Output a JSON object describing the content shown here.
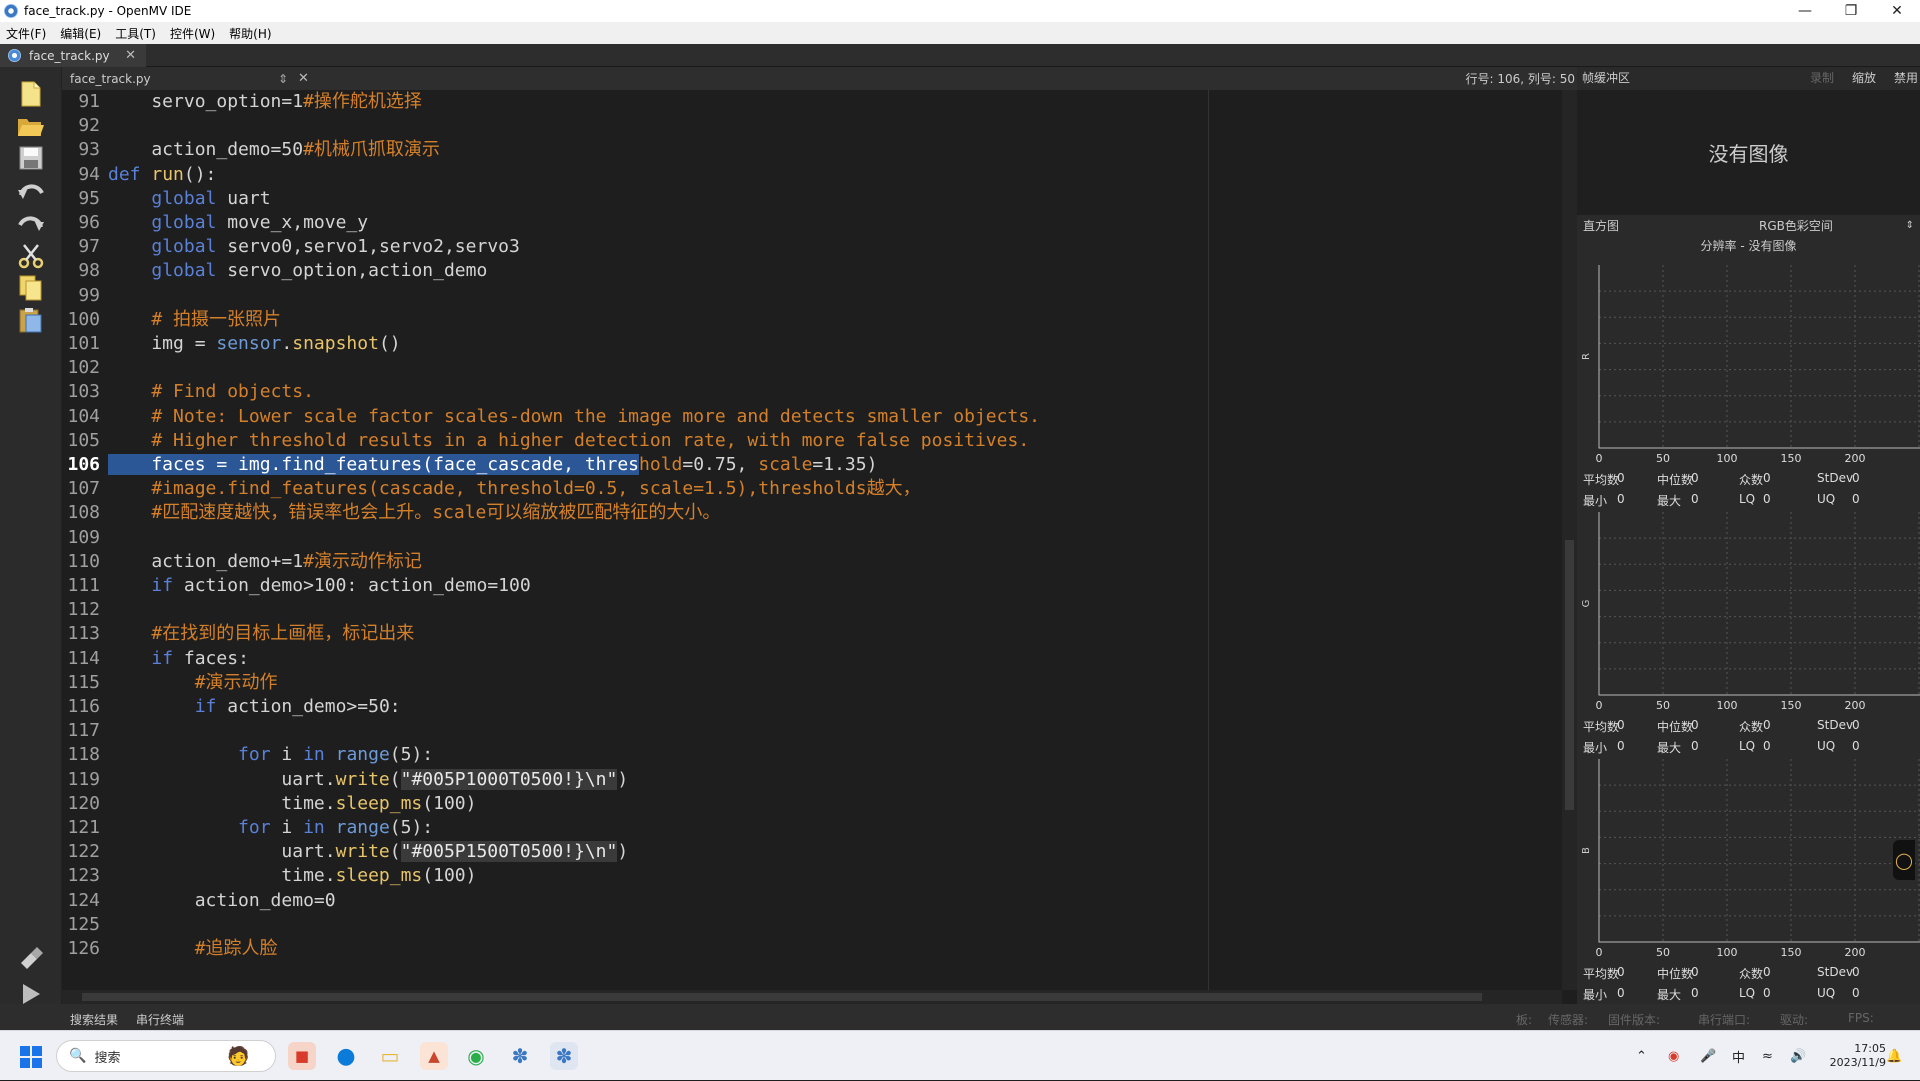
{
  "window": {
    "title": "face_track.py - OpenMV IDE"
  },
  "menu": [
    "文件(F)",
    "编辑(E)",
    "工具(T)",
    "控件(W)",
    "帮助(H)"
  ],
  "tab": {
    "label": "face_track.py"
  },
  "editor": {
    "filename": "face_track.py",
    "position": "行号: 106, 列号: 50",
    "lines": [
      {
        "n": "91",
        "t": "    servo_option=1#操作舵机选择"
      },
      {
        "n": "92",
        "t": ""
      },
      {
        "n": "93",
        "t": "    action_demo=50#机械爪抓取演示"
      },
      {
        "n": "94",
        "t": "def run():"
      },
      {
        "n": "95",
        "t": "    global uart"
      },
      {
        "n": "96",
        "t": "    global move_x,move_y"
      },
      {
        "n": "97",
        "t": "    global servo0,servo1,servo2,servo3"
      },
      {
        "n": "98",
        "t": "    global servo_option,action_demo"
      },
      {
        "n": "99",
        "t": ""
      },
      {
        "n": "100",
        "t": "    # 拍摄一张照片"
      },
      {
        "n": "101",
        "t": "    img = sensor.snapshot()"
      },
      {
        "n": "102",
        "t": ""
      },
      {
        "n": "103",
        "t": "    # Find objects."
      },
      {
        "n": "104",
        "t": "    # Note: Lower scale factor scales-down the image more and detects smaller objects."
      },
      {
        "n": "105",
        "t": "    # Higher threshold results in a higher detection rate, with more false positives."
      },
      {
        "n": "106",
        "t": "    faces = img.find_features(face_cascade, threshold=0.75, scale=1.35)"
      },
      {
        "n": "107",
        "t": "    #image.find_features(cascade, threshold=0.5, scale=1.5),thresholds越大，"
      },
      {
        "n": "108",
        "t": "    #匹配速度越快，错误率也会上升。scale可以缩放被匹配特征的大小。"
      },
      {
        "n": "109",
        "t": ""
      },
      {
        "n": "110",
        "t": "    action_demo+=1#演示动作标记"
      },
      {
        "n": "111",
        "t": "    if action_demo>100: action_demo=100"
      },
      {
        "n": "112",
        "t": ""
      },
      {
        "n": "113",
        "t": "    #在找到的目标上画框，标记出来"
      },
      {
        "n": "114",
        "t": "    if faces:"
      },
      {
        "n": "115",
        "t": "        #演示动作"
      },
      {
        "n": "116",
        "t": "        if action_demo>=50:"
      },
      {
        "n": "117",
        "t": ""
      },
      {
        "n": "118",
        "t": "            for i in range(5):"
      },
      {
        "n": "119",
        "t": "                uart.write(\"#005P1000T0500!}\\n\")"
      },
      {
        "n": "120",
        "t": "                time.sleep_ms(100)"
      },
      {
        "n": "121",
        "t": "            for i in range(5):"
      },
      {
        "n": "122",
        "t": "                uart.write(\"#005P1500T0500!}\\n\")"
      },
      {
        "n": "123",
        "t": "                time.sleep_ms(100)"
      },
      {
        "n": "124",
        "t": "        action_demo=0"
      },
      {
        "n": "125",
        "t": ""
      },
      {
        "n": "126",
        "t": "        #追踪人脸"
      }
    ]
  },
  "right_panel": {
    "framebuffer_label": "帧缓冲区",
    "top_buttons": [
      "录制",
      "缩放",
      "禁用"
    ],
    "no_image": "没有图像",
    "histogram_label": "直方图",
    "colorspace": "RGB色彩空间",
    "resolution": "分辨率 - 没有图像",
    "channels": [
      "R",
      "G",
      "B"
    ],
    "ticks": [
      "0",
      "50",
      "100",
      "150",
      "200"
    ],
    "stats_row1": [
      "平均数",
      "0",
      "中位数",
      "0",
      "众数",
      "0",
      "StDev",
      "0"
    ],
    "stats_row2": [
      "最小",
      "0",
      "最大",
      "0",
      "LQ",
      "0",
      "UQ",
      "0"
    ]
  },
  "bottom": {
    "tabs": [
      "搜索结果",
      "串行终端"
    ],
    "status": [
      "板:",
      "传感器:",
      "固件版本:",
      "串行端口:",
      "驱动:",
      "FPS:"
    ]
  },
  "taskbar": {
    "search_placeholder": "搜索",
    "ime": "中",
    "time": "17:05",
    "date": "2023/11/9"
  }
}
